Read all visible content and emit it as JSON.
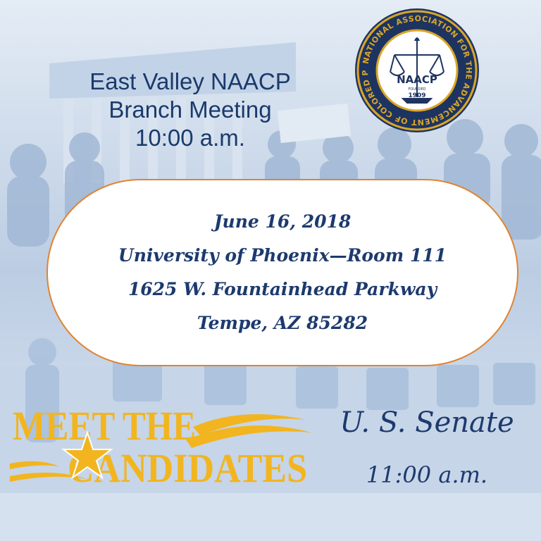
{
  "header": {
    "line1": "East Valley NAACP",
    "line2": "Branch Meeting",
    "line3": "10:00 a.m."
  },
  "seal": {
    "ring_text": "NATIONAL ASSOCIATION FOR THE ADVANCEMENT OF COLORED PEOPLE",
    "name": "NAACP",
    "founded_label": "FOUNDED",
    "founded_year": "1909"
  },
  "event": {
    "date": "June 16, 2018",
    "venue": "University of Phoenix—Room 111",
    "street": "1625 W. Fountainhead Parkway",
    "city": "Tempe, AZ 85282"
  },
  "meet": {
    "line1": "MEET THE",
    "line2": "CANDIDATES",
    "race": "U. S. Senate",
    "time": "11:00 a.m."
  },
  "colors": {
    "navy": "#1d3a6e",
    "gold": "#f2b51f",
    "border": "#e0832f",
    "background": "#cfdcec"
  }
}
